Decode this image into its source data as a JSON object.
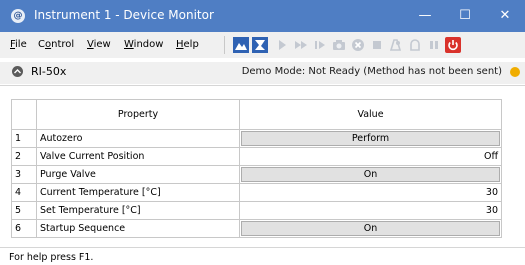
{
  "window": {
    "title": "Instrument 1 - Device Monitor",
    "icon": "app-logo-icon"
  },
  "window_controls": {
    "minimize": "—",
    "maximize": "☐",
    "close": "✕"
  },
  "menu": [
    {
      "label": "File",
      "key": "F"
    },
    {
      "label": "Control",
      "key": "o"
    },
    {
      "label": "View",
      "key": "V"
    },
    {
      "label": "Window",
      "key": "W"
    },
    {
      "label": "Help",
      "key": "H"
    }
  ],
  "toolbar_icons": [
    "mountain-icon",
    "method-icon",
    "play-icon",
    "fast-forward-icon",
    "step-icon",
    "camera-icon",
    "stop-circle-icon",
    "stop-icon",
    "pump-icon",
    "lamp-icon",
    "pause-icon",
    "power-icon"
  ],
  "instrument": {
    "name": "RI-50x",
    "status": "Demo Mode: Not Ready (Method has not been sent)"
  },
  "colors": {
    "titlebar": "#4f7ec4",
    "power": "#d9322b",
    "status_indicator": "#f0ad00"
  },
  "table": {
    "headers": {
      "property": "Property",
      "value": "Value"
    },
    "rows": [
      {
        "n": "1",
        "property": "Autozero",
        "value": "Perform",
        "button": true
      },
      {
        "n": "2",
        "property": "Valve Current Position",
        "value": "Off",
        "button": false
      },
      {
        "n": "3",
        "property": "Purge Valve",
        "value": "On",
        "button": true
      },
      {
        "n": "4",
        "property": "Current Temperature [°C]",
        "value": "30",
        "button": false
      },
      {
        "n": "5",
        "property": "Set Temperature [°C]",
        "value": "30",
        "button": false
      },
      {
        "n": "6",
        "property": "Startup Sequence",
        "value": "On",
        "button": true
      }
    ]
  },
  "status_bar": {
    "help": "For help press F1."
  }
}
